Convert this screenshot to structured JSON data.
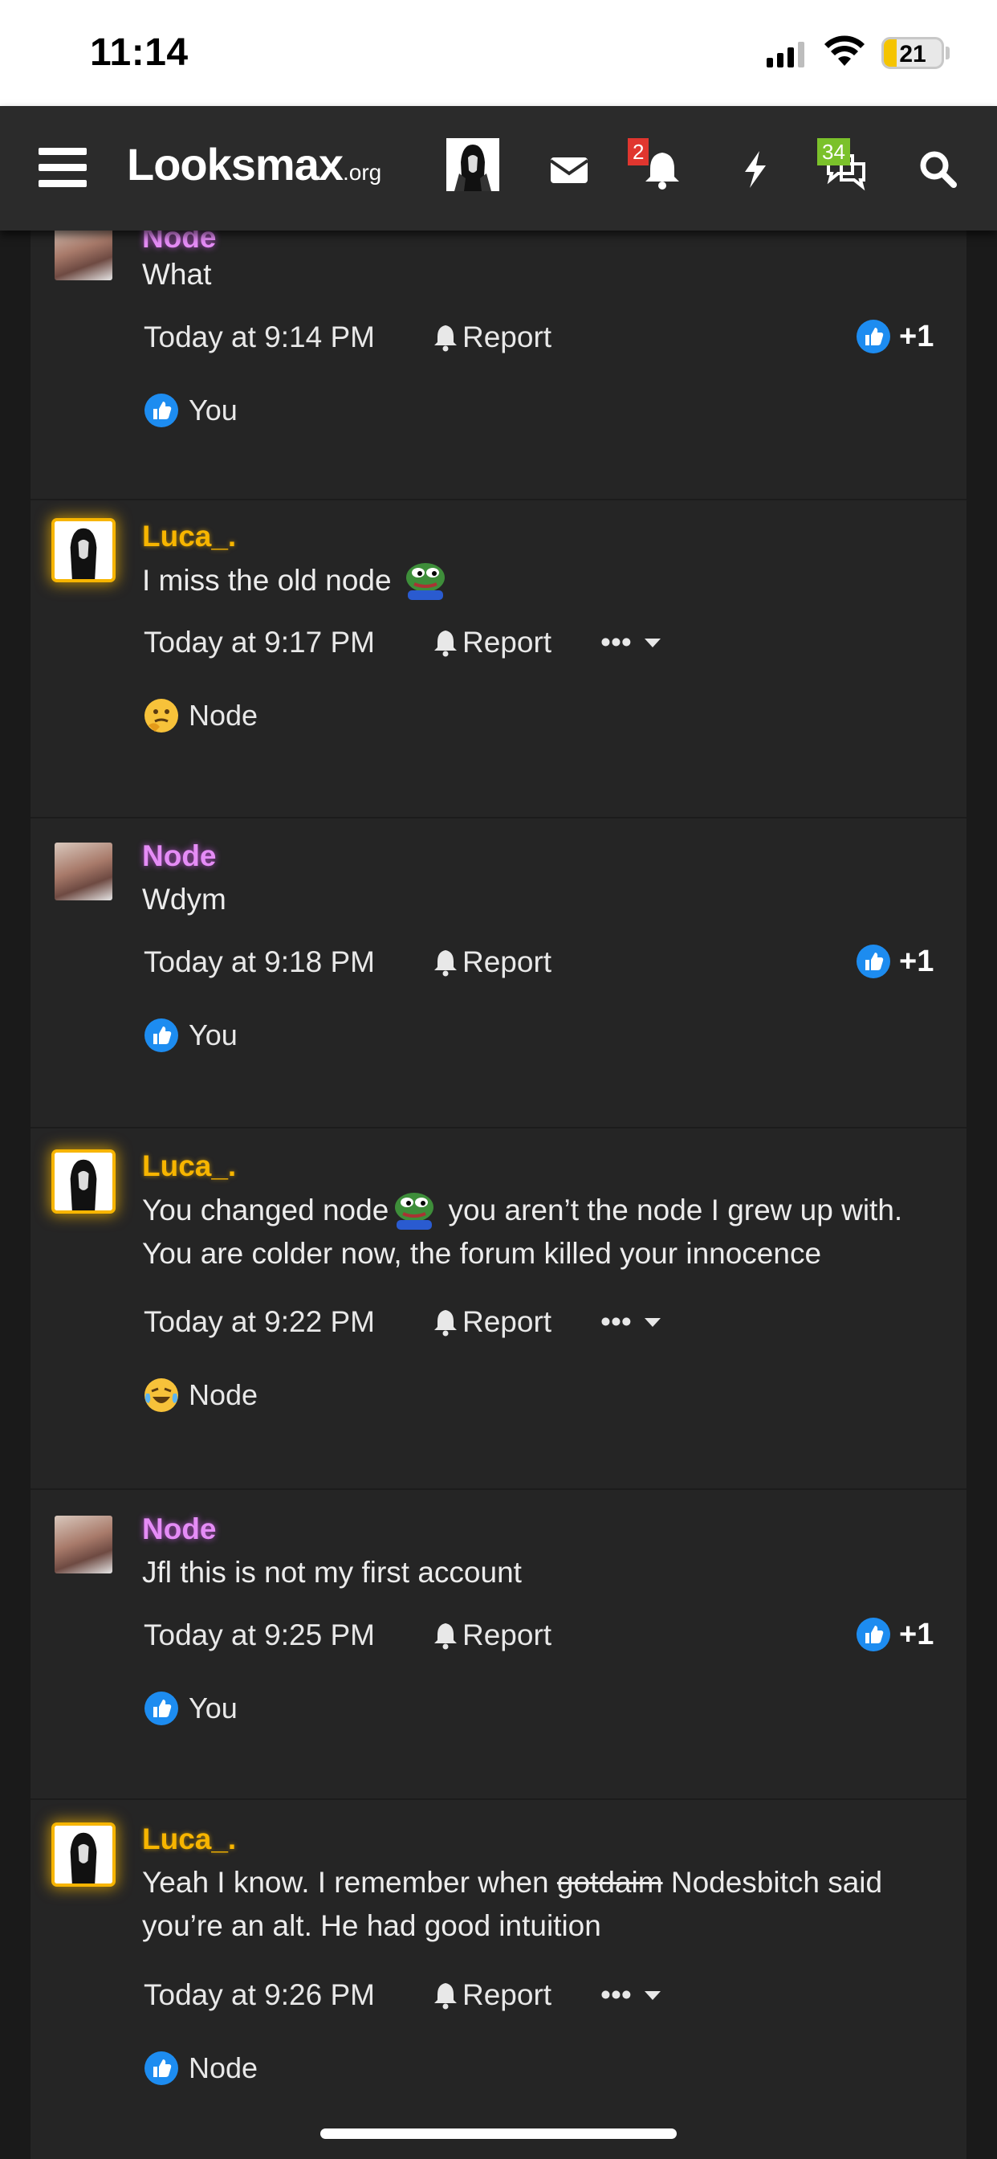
{
  "status_bar": {
    "time": "11:14",
    "battery": "21"
  },
  "nav": {
    "logo_main": "Looksmax",
    "logo_suffix": ".org",
    "notifications_badge": "2",
    "conversations_badge": "34",
    "icons": [
      "menu-icon",
      "avatar",
      "mail-icon",
      "bell-icon",
      "lightning-icon",
      "chat-icon",
      "search-icon"
    ]
  },
  "posts": [
    {
      "user": "Node",
      "message": "What",
      "time": "Today at 9:14 PM",
      "report": "Report",
      "like_count": "+1",
      "reaction_icon": "like",
      "reaction_user": "You"
    },
    {
      "user": "Luca_.",
      "message": "I miss the old node",
      "time": "Today at 9:17 PM",
      "report": "Report",
      "more": "•••",
      "reaction_icon": "thinking",
      "reaction_user": "Node"
    },
    {
      "user": "Node",
      "message": "Wdym",
      "time": "Today at 9:18 PM",
      "report": "Report",
      "like_count": "+1",
      "reaction_icon": "like",
      "reaction_user": "You"
    },
    {
      "user": "Luca_.",
      "message_a": "You changed node",
      "message_b": " you aren’t the node I grew up with. You are colder now, the forum killed your innocence",
      "time": "Today at 9:22 PM",
      "report": "Report",
      "more": "•••",
      "reaction_icon": "crying-laughing",
      "reaction_user": "Node"
    },
    {
      "user": "Node",
      "message": "Jfl this is not my first account",
      "time": "Today at 9:25 PM",
      "report": "Report",
      "like_count": "+1",
      "reaction_icon": "like",
      "reaction_user": "You"
    },
    {
      "user": "Luca_.",
      "message_a": "Yeah I know. I remember when ",
      "message_strike": "gotdaim",
      "message_b": " Nodesbitch said you’re an alt. He had good intuition",
      "time": "Today at 9:26 PM",
      "report": "Report",
      "more": "•••",
      "reaction_icon": "like",
      "reaction_user": "Node"
    }
  ],
  "colors": {
    "node_name": "#e58cf6",
    "luca_name": "#f7b500",
    "like_blue": "#1d8cf0",
    "background": "#252525"
  }
}
